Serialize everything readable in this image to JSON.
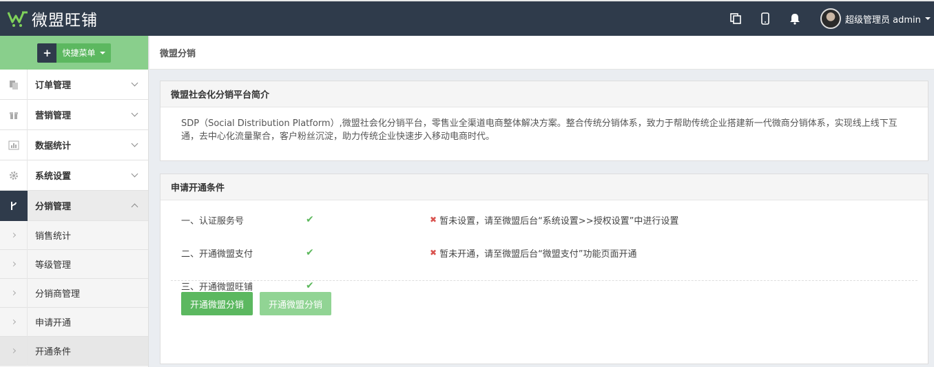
{
  "header": {
    "logo_text": "微盟旺铺",
    "user_name": "超级管理员 admin",
    "icons": [
      "copy-icon",
      "mobile-icon",
      "bell-icon"
    ]
  },
  "sidebar": {
    "quick_menu_label": "快捷菜单",
    "items": [
      {
        "label": "订单管理",
        "icon": "order-icon"
      },
      {
        "label": "营销管理",
        "icon": "gift-icon"
      },
      {
        "label": "数据统计",
        "icon": "bar-chart-icon"
      },
      {
        "label": "系统设置",
        "icon": "gear-icon"
      },
      {
        "label": "分销管理",
        "icon": "fork-icon"
      }
    ],
    "sub_items": [
      {
        "label": "销售统计"
      },
      {
        "label": "等级管理"
      },
      {
        "label": "分销商管理"
      },
      {
        "label": "申请开通"
      },
      {
        "label": "开通条件"
      }
    ]
  },
  "main": {
    "breadcrumb": "微盟分销",
    "intro_panel": {
      "title": "微盟社会化分销平台简介",
      "text": "SDP（Social Distribution Platform）,微盟社会化分销平台，零售业全渠道电商整体解决方案。整合传统分销体系，致力于帮助传统企业搭建新一代微商分销体系，实现线上线下互通，去中心化流量聚合，客户粉丝沉淀，助力传统企业快速步入移动电商时代。"
    },
    "conditions_panel": {
      "title": "申请开通条件",
      "conditions": [
        {
          "name": "一、认证服务号",
          "status_icon": "check-icon",
          "warning": "暂未设置，请至微盟后台“系统设置>>授权设置”中进行设置"
        },
        {
          "name": "二、开通微盟支付",
          "status_icon": "check-icon",
          "warning": "暂未开通，请至微盟后台“微盟支付”功能页面开通"
        },
        {
          "name": "三、开通微盟旺铺",
          "status_icon": "check-icon",
          "warning": ""
        }
      ],
      "button_primary": "开通微盟分销",
      "button_disabled": "开通微盟分销"
    }
  },
  "colors": {
    "topbar": "#2f3b4b",
    "accent_green": "#5cb860",
    "quick_menu_bg": "#89cf8c",
    "check": "#5cb85c",
    "warning_x": "#d9534f"
  }
}
